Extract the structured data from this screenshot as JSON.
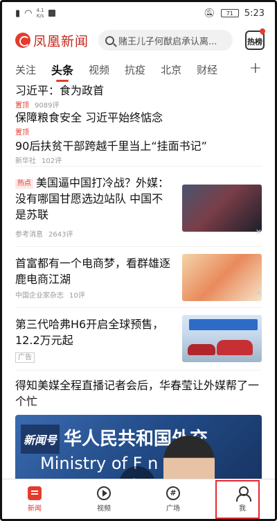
{
  "status_bar": {
    "net_speed": "4.1",
    "net_unit": "K/s",
    "battery": "71",
    "time": "5:23"
  },
  "header": {
    "logo_text": "凤凰新闻",
    "search_placeholder": "赌王儿子何猷启承认离...",
    "hot_label": "热榜"
  },
  "tabs": [
    "关注",
    "头条",
    "视频",
    "抗疫",
    "北京",
    "财经"
  ],
  "active_tab": "头条",
  "feed": {
    "top1": {
      "title": "习近平：食为政首",
      "tag": "置顶",
      "comments": "9089评"
    },
    "top2": {
      "title": "保障粮食安全 习近平始终惦念",
      "tag": "置顶"
    },
    "top3": {
      "title": "90后扶贫干部跨越千里当上“挂面书记”",
      "source": "新华社",
      "comments": "102评"
    },
    "card1": {
      "tag": "热点",
      "title": "美国逼中国打冷战？外媒：没有哪国甘愿选边站队 中国不是苏联",
      "source": "参考消息",
      "comments": "2643评"
    },
    "card2": {
      "title": "首富都有一个电商梦，看群雄逐鹿电商江湖",
      "source": "中国企业家杂志",
      "comments": "10评"
    },
    "card3": {
      "title": "第三代哈弗H6开启全球预售，12.2万元起",
      "tag": "广告"
    },
    "card4": {
      "title": "得知美媒全程直播记者会后，华春莹让外媒帮了一个忙",
      "video_logo": "新闻号",
      "video_cn": "华人民共和国外交",
      "video_en": "Ministry of F   n Affa"
    }
  },
  "bottom_nav": [
    {
      "label": "新闻",
      "icon": "news-icon"
    },
    {
      "label": "视频",
      "icon": "play-circle-icon"
    },
    {
      "label": "广场",
      "icon": "hash-icon"
    },
    {
      "label": "我",
      "icon": "user-icon"
    }
  ],
  "colors": {
    "brand": "#e33c2d",
    "highlight": "#e6262d"
  }
}
